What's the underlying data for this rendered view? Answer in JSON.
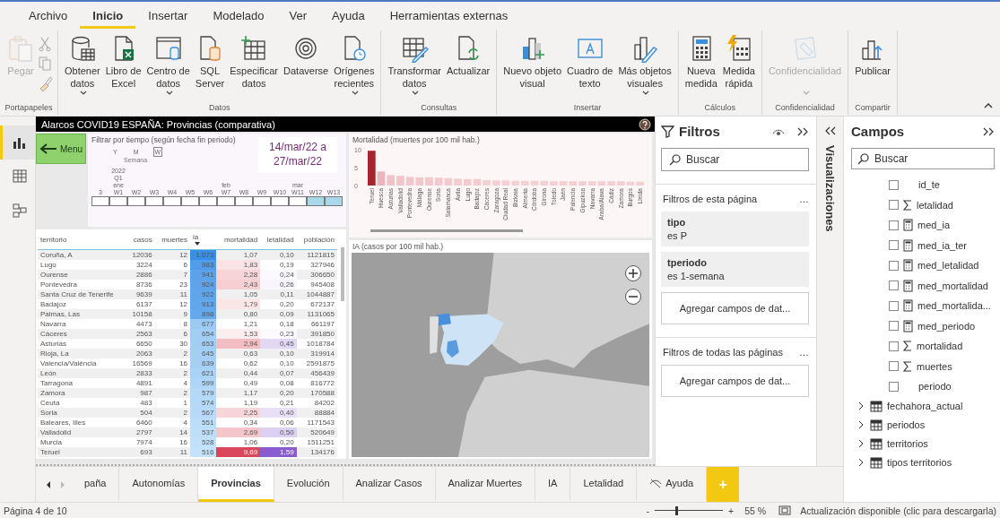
{
  "ribbon": {
    "tabs": [
      {
        "label": "Archivo",
        "selected": false
      },
      {
        "label": "Inicio",
        "selected": true
      },
      {
        "label": "Insertar",
        "selected": false
      },
      {
        "label": "Modelado",
        "selected": false
      },
      {
        "label": "Ver",
        "selected": false
      },
      {
        "label": "Ayuda",
        "selected": false
      },
      {
        "label": "Herramientas externas",
        "selected": false
      }
    ],
    "groups": [
      {
        "label": "Portapapeles",
        "buttons": [
          {
            "label": "Pegar",
            "dropdown": false,
            "disabled": true
          }
        ]
      },
      {
        "label": "Datos",
        "buttons": [
          {
            "label": "Obtener\ndatos",
            "dropdown": true,
            "disabled": false
          },
          {
            "label": "Libro de\nExcel",
            "dropdown": false,
            "disabled": false
          },
          {
            "label": "Centro de\ndatos",
            "dropdown": true,
            "disabled": false
          },
          {
            "label": "SQL\nServer",
            "dropdown": false,
            "disabled": false
          },
          {
            "label": "Especificar\ndatos",
            "dropdown": false,
            "disabled": false
          },
          {
            "label": "Dataverse",
            "dropdown": false,
            "disabled": false
          },
          {
            "label": "Orígenes\nrecientes",
            "dropdown": true,
            "disabled": false
          }
        ]
      },
      {
        "label": "Consultas",
        "buttons": [
          {
            "label": "Transformar\ndatos",
            "dropdown": true,
            "disabled": false
          },
          {
            "label": "Actualizar",
            "dropdown": false,
            "disabled": false
          }
        ]
      },
      {
        "label": "Insertar",
        "buttons": [
          {
            "label": "Nuevo objeto\nvisual",
            "dropdown": false,
            "disabled": false
          },
          {
            "label": "Cuadro de\ntexto",
            "dropdown": false,
            "disabled": false
          },
          {
            "label": "Más objetos\nvisuales",
            "dropdown": true,
            "disabled": false
          }
        ]
      },
      {
        "label": "Cálculos",
        "buttons": [
          {
            "label": "Nueva\nmedida",
            "dropdown": false,
            "disabled": false
          },
          {
            "label": "Medida\nrápida",
            "dropdown": false,
            "disabled": false
          }
        ]
      },
      {
        "label": "Confidencialidad",
        "buttons": [
          {
            "label": "Confidencialidad",
            "dropdown": true,
            "disabled": true
          }
        ]
      },
      {
        "label": "Compartir",
        "buttons": [
          {
            "label": "Publicar",
            "dropdown": false,
            "disabled": false
          }
        ]
      }
    ]
  },
  "nav": [
    {
      "selected": true
    },
    {
      "selected": false
    },
    {
      "selected": false
    }
  ],
  "report": {
    "title": "Alarcos COVID19 ESPAÑA: Provincias (comparativa)",
    "menu_button": "Menu",
    "slicer": {
      "title": "Filtrar por tiempo (según fecha fin periodo)",
      "levels": [
        {
          "label": "Y",
          "selected": false
        },
        {
          "label": "M",
          "selected": false
        },
        {
          "label": "W",
          "selected": true
        }
      ],
      "level_caption": "Semana",
      "periods": [
        {
          "label": "3",
          "selected": false
        },
        {
          "label": "W1",
          "year": "2022",
          "quarter": "Q1",
          "month": "ene",
          "selected": false
        },
        {
          "label": "W2",
          "selected": false
        },
        {
          "label": "W3",
          "selected": false
        },
        {
          "label": "W4",
          "selected": false
        },
        {
          "label": "W5",
          "selected": false
        },
        {
          "label": "W6",
          "selected": false
        },
        {
          "label": "W7",
          "month": "feb",
          "selected": false
        },
        {
          "label": "W8",
          "selected": false
        },
        {
          "label": "W9",
          "selected": false
        },
        {
          "label": "W10",
          "selected": false
        },
        {
          "label": "W11",
          "month": "mar",
          "selected": false
        },
        {
          "label": "W12",
          "selected": true
        },
        {
          "label": "W13",
          "selected": true
        }
      ]
    },
    "date_range": "14/mar/22 a\n27/mar/22",
    "table": {
      "columns": [
        {
          "label": "territorio",
          "sorted": false
        },
        {
          "label": "casos",
          "sorted": false
        },
        {
          "label": "muertes",
          "sorted": false
        },
        {
          "label": "ia",
          "sorted": true
        },
        {
          "label": "mortalidad",
          "sorted": false
        },
        {
          "label": "letalidad",
          "sorted": false
        },
        {
          "label": "población",
          "sorted": false
        }
      ],
      "rows": [
        [
          "Coruña, A",
          "12036",
          "12",
          "1.073",
          "1,07",
          "0,10",
          "1121815"
        ],
        [
          "Lugo",
          "3224",
          "6",
          "983",
          "1,83",
          "0,19",
          "327946"
        ],
        [
          "Ourense",
          "2886",
          "7",
          "941",
          "2,28",
          "0,24",
          "306650"
        ],
        [
          "Pontevedra",
          "8736",
          "23",
          "924",
          "2,43",
          "0,26",
          "945408"
        ],
        [
          "Santa Cruz de Tenerife",
          "9639",
          "11",
          "922",
          "1,05",
          "0,11",
          "1044887"
        ],
        [
          "Badajoz",
          "6137",
          "12",
          "913",
          "1,79",
          "0,20",
          "672137"
        ],
        [
          "Palmas, Las",
          "10158",
          "9",
          "898",
          "0,80",
          "0,09",
          "1131065"
        ],
        [
          "Navarra",
          "4473",
          "8",
          "677",
          "1,21",
          "0,18",
          "661197"
        ],
        [
          "Cáceres",
          "2563",
          "6",
          "654",
          "1,53",
          "0,23",
          "391850"
        ],
        [
          "Asturias",
          "6650",
          "30",
          "653",
          "2,94",
          "0,45",
          "1018784"
        ],
        [
          "Rioja, La",
          "2063",
          "2",
          "645",
          "0,63",
          "0,10",
          "319914"
        ],
        [
          "Valencia/València",
          "16569",
          "16",
          "639",
          "0,62",
          "0,10",
          "2591875"
        ],
        [
          "León",
          "2833",
          "2",
          "621",
          "0,44",
          "0,07",
          "456439"
        ],
        [
          "Tarragona",
          "4891",
          "4",
          "599",
          "0,49",
          "0,08",
          "816772"
        ],
        [
          "Zamora",
          "987",
          "2",
          "579",
          "1,17",
          "0,20",
          "170588"
        ],
        [
          "Ceuta",
          "483",
          "1",
          "574",
          "1,19",
          "0,21",
          "84202"
        ],
        [
          "Soria",
          "504",
          "2",
          "567",
          "2,25",
          "0,40",
          "88884"
        ],
        [
          "Baleares, Illes",
          "6460",
          "4",
          "551",
          "0,34",
          "0,06",
          "1171543"
        ],
        [
          "Valladolid",
          "2797",
          "14",
          "537",
          "2,69",
          "0,50",
          "520649"
        ],
        [
          "Murcia",
          "7974",
          "16",
          "528",
          "1,06",
          "0,20",
          "1511251"
        ],
        [
          "Teruel",
          "693",
          "11",
          "516",
          "9,69",
          "1,59",
          "134176"
        ]
      ]
    },
    "bar_chart": {
      "title": "Mortalidad (muertes por 100 mil hab.)",
      "chart_data": {
        "type": "bar",
        "categories": [
          "Teruel",
          "Huesca",
          "Asturias",
          "Valladolid",
          "Pontevedra",
          "Málaga",
          "Ourense",
          "Soria",
          "Salamanca",
          "Ávila",
          "Lugo",
          "Badajoz",
          "Cáceres",
          "Zaragoza",
          "Ciudad Real",
          "Bizkaia",
          "Almería",
          "Córdoba",
          "Girona",
          "Toledo",
          "Jaén",
          "Palencia",
          "Gipuzkoa",
          "Navarra",
          "Araba/Álava",
          "Cádiz",
          "Zamora",
          "Burgos",
          "Lleida"
        ],
        "values": [
          9.7,
          3.9,
          2.9,
          2.7,
          2.4,
          2.3,
          2.3,
          2.2,
          2.1,
          1.9,
          1.8,
          1.8,
          1.5,
          1.4,
          1.4,
          1.3,
          1.3,
          1.3,
          1.3,
          1.2,
          1.2,
          1.2,
          1.2,
          1.2,
          1.2,
          1.2,
          1.2,
          1.1,
          1.1
        ],
        "yticks": [
          0,
          5,
          10
        ],
        "ylim": [
          0,
          10
        ]
      }
    },
    "map": {
      "title": "IA (casos por 100 mil hab.)"
    }
  },
  "filters": {
    "title": "Filtros",
    "search_placeholder": "Buscar",
    "page_section": "Filtros de esta página",
    "page_more": "…",
    "cards": [
      {
        "field": "tipo",
        "condition": "es P"
      },
      {
        "field": "tperiodo",
        "condition": "es 1-semana"
      }
    ],
    "add_page": "Agregar campos de dat...",
    "all_section": "Filtros de todas las páginas",
    "all_more": "…",
    "add_all": "Agregar campos de dat..."
  },
  "visualizations": {
    "title": "Visualizaciones"
  },
  "fields": {
    "title": "Campos",
    "search_placeholder": "Buscar",
    "items": [
      {
        "name": "id_te",
        "kind": "column",
        "checked": false
      },
      {
        "name": "letalidad",
        "kind": "sum",
        "checked": false
      },
      {
        "name": "med_ia",
        "kind": "measure",
        "checked": false
      },
      {
        "name": "med_ia_ter",
        "kind": "measure",
        "checked": false
      },
      {
        "name": "med_letalidad",
        "kind": "measure",
        "checked": false
      },
      {
        "name": "med_mortalidad",
        "kind": "measure",
        "checked": false
      },
      {
        "name": "med_mortalida...",
        "kind": "measure",
        "checked": false
      },
      {
        "name": "med_periodo",
        "kind": "measure",
        "checked": false
      },
      {
        "name": "mortalidad",
        "kind": "sum",
        "checked": false
      },
      {
        "name": "muertes",
        "kind": "sum",
        "checked": false
      },
      {
        "name": "periodo",
        "kind": "column",
        "checked": false
      }
    ],
    "tables": [
      {
        "name": "fechahora_actual",
        "expanded": false
      },
      {
        "name": "periodos",
        "expanded": false
      },
      {
        "name": "territorios",
        "expanded": false
      },
      {
        "name": "tipos territorios",
        "expanded": false
      }
    ]
  },
  "page_tabs": {
    "tabs": [
      {
        "label": "paña",
        "selected": false
      },
      {
        "label": "Autonomías",
        "selected": false
      },
      {
        "label": "Provincias",
        "selected": true
      },
      {
        "label": "Evolución",
        "selected": false
      },
      {
        "label": "Analizar Casos",
        "selected": false
      },
      {
        "label": "Analizar Muertes",
        "selected": false
      },
      {
        "label": "IA",
        "selected": false
      },
      {
        "label": "Letalidad",
        "selected": false
      },
      {
        "label": "Ayuda",
        "selected": false
      }
    ],
    "add": "+"
  },
  "status_bar": {
    "page": "Página 4 de 10",
    "zoom_out": "-",
    "zoom_in": "+",
    "zoom": {
      "level": 0.3
    },
    "zoom_text": "55 %",
    "update": "Actualización disponible (clic para descargarla)"
  }
}
